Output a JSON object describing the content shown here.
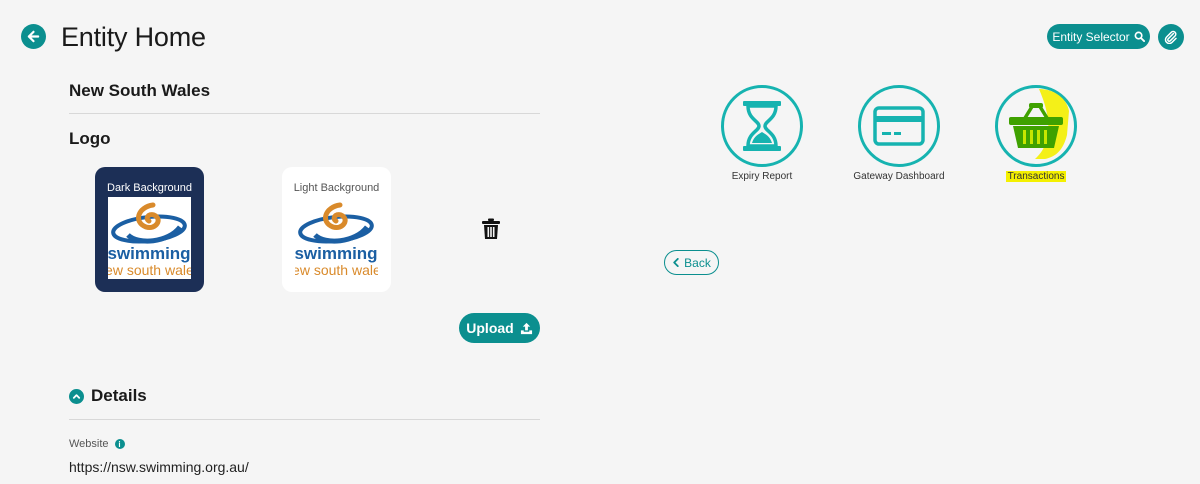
{
  "header": {
    "title": "Entity Home",
    "entity_selector_label": "Entity Selector"
  },
  "entity": {
    "name": "New South Wales"
  },
  "logo": {
    "section_title": "Logo",
    "dark_caption": "Dark Background",
    "light_caption": "Light Background",
    "brand_line1": "swimming",
    "brand_line2": "new south wales",
    "upload_label": "Upload"
  },
  "details": {
    "section_title": "Details",
    "website_label": "Website",
    "website_value": "https://nsw.swimming.org.au/"
  },
  "tiles": [
    {
      "label": "Expiry Report",
      "icon": "hourglass-icon"
    },
    {
      "label": "Gateway Dashboard",
      "icon": "credit-card-icon"
    },
    {
      "label": "Transactions",
      "icon": "basket-icon"
    }
  ],
  "back_label": "Back",
  "colors": {
    "primary": "#0b8f8f",
    "ring": "#16b3b0",
    "dark_logo_bg": "#1c2f56",
    "highlight": "#f4f000"
  }
}
